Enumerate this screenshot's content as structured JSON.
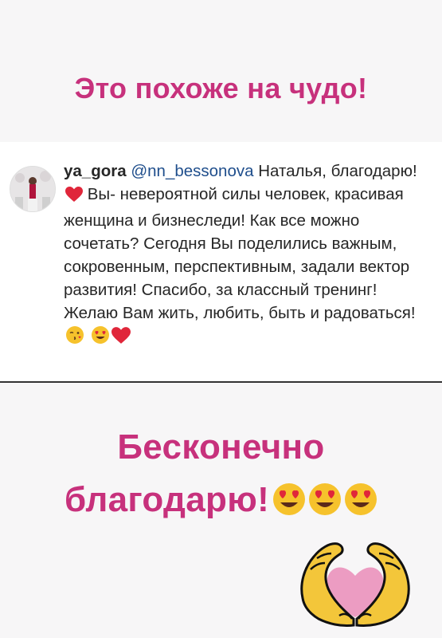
{
  "headline_top": "Это похоже на чудо!",
  "comment": {
    "username": "ya_gora",
    "mention": "@nn_bessonova",
    "text_1": " Наталья, благодарю!",
    "text_2": " Вы- невероятной силы человек, красивая женщина и бизнеследи! Как все можно сочетать? Сегодня Вы поделились важным, сокровенным, перспективным, задали вектор развития! Спасибо, за классный тренинг! Желаю Вам жить, любить, быть и радоваться! ",
    "emojis": [
      "red-heart",
      "kissing-face",
      "heart-eyes-face",
      "red-heart"
    ]
  },
  "headline_bottom_line1": "Бесконечно",
  "headline_bottom_line2": "благодарю!",
  "colors": {
    "accent": "#c7317c",
    "mention": "#1f4e8c",
    "heart": "#e0263a",
    "emoji_face": "#f6c22c",
    "hands_fill": "#f3c63a",
    "heart_fill": "#ec9cc2"
  }
}
